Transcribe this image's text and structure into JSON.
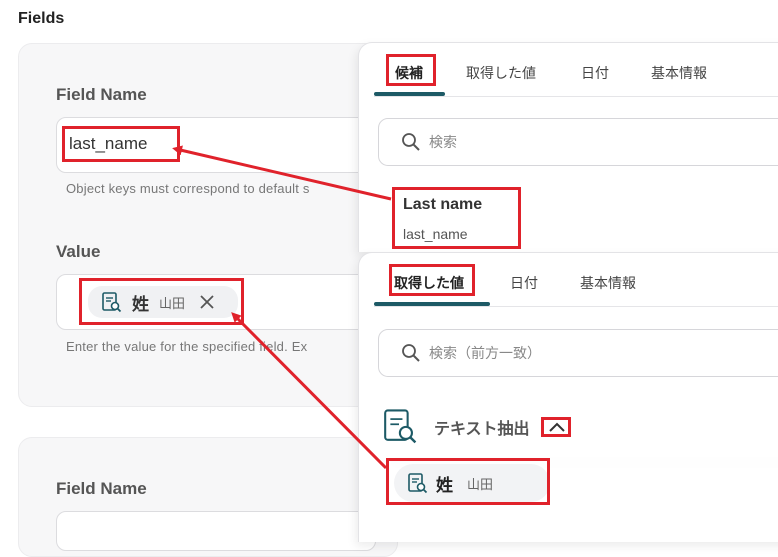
{
  "fields_title": "Fields",
  "card1": {
    "field_name_label": "Field Name",
    "field_name_value": "last_name",
    "field_name_help": "Object keys must correspond to default s",
    "value_label": "Value",
    "value_chip": {
      "icon": "document-search-icon",
      "main": "姓",
      "sub": "山田"
    },
    "value_help": "Enter the value for the specified field. Ex"
  },
  "card2": {
    "field_name_label": "Field Name"
  },
  "panel1": {
    "tabs": [
      "候補",
      "取得した値",
      "日付",
      "基本情報"
    ],
    "search_placeholder": "検索",
    "candidate": {
      "title": "Last name",
      "subtitle": "last_name"
    }
  },
  "panel2": {
    "tabs": [
      "取得した値",
      "日付",
      "基本情報"
    ],
    "search_placeholder": "検索（前方一致）",
    "section": {
      "icon": "document-search-icon",
      "title": "テキスト抽出",
      "toggle_icon": "chevron-up-icon"
    },
    "item": {
      "main": "姓",
      "sub": "山田"
    }
  },
  "colors": {
    "annotation_red": "#e0222b",
    "tab_accent": "#1d5a66"
  }
}
